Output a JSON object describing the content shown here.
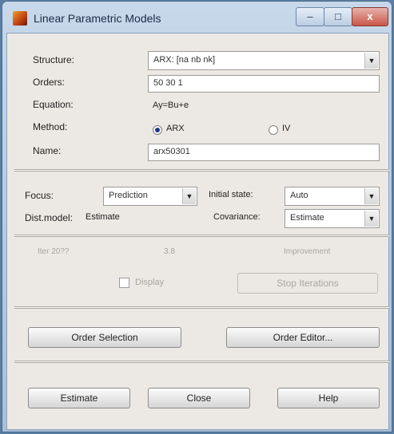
{
  "window": {
    "title": "Linear Parametric Models",
    "minimize_glyph": "–",
    "maximize_glyph": "□",
    "close_glyph": "x"
  },
  "model": {
    "structure_label": "Structure:",
    "structure_value": "ARX: [na nb nk]",
    "orders_label": "Orders:",
    "orders_value": "50 30 1",
    "equation_label": "Equation:",
    "equation_value": "Ay=Bu+e",
    "method_label": "Method:",
    "method_arx": "ARX",
    "method_iv": "IV",
    "method_selected": "ARX",
    "name_label": "Name:",
    "name_value": "arx50301"
  },
  "options": {
    "focus_label": "Focus:",
    "focus_value": "Prediction",
    "initial_state_label": "Initial state:",
    "initial_state_value": "Auto",
    "dist_model_label": "Dist.model:",
    "dist_model_value": "Estimate",
    "covariance_label": "Covariance:",
    "covariance_value": "Estimate"
  },
  "advanced": {
    "label1": "Iter 20??",
    "label2": "3.8",
    "label3": "Improvement",
    "display_label": "Display",
    "stop_iterations_label": "Stop Iterations"
  },
  "order_buttons": {
    "order_selection": "Order Selection",
    "order_editor": "Order Editor..."
  },
  "actions": {
    "estimate": "Estimate",
    "close": "Close",
    "help": "Help"
  },
  "icons": {
    "app": "matlab-icon",
    "dropdown": "chevron-down-icon"
  }
}
